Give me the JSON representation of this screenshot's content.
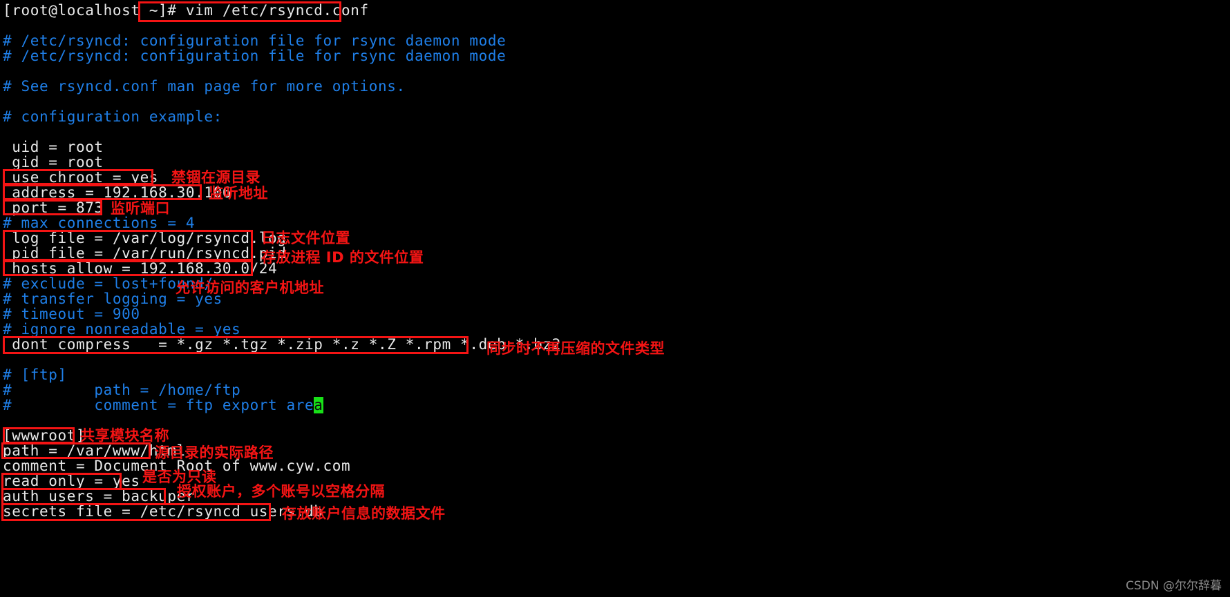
{
  "terminal": {
    "prompt": "[root@localhost ~]#",
    "command": " vim /etc/rsyncd.conf",
    "cursor_char": "a"
  },
  "file": {
    "path": "/etc/rsyncd.conf",
    "lines": [
      {
        "text": "# /etc/rsyncd: configuration file for rsync daemon mode",
        "kind": "comment"
      },
      {
        "text": "# /etc/rsyncd: configuration file for rsync daemon mode",
        "kind": "comment"
      },
      {
        "text": "",
        "kind": "blank"
      },
      {
        "text": "# See rsyncd.conf man page for more options.",
        "kind": "comment"
      },
      {
        "text": "",
        "kind": "blank"
      },
      {
        "text": "# configuration example:",
        "kind": "comment"
      },
      {
        "text": "",
        "kind": "blank"
      },
      {
        "text": " uid = root",
        "kind": "code"
      },
      {
        "text": " gid = root",
        "kind": "code"
      },
      {
        "text": " use chroot = yes",
        "kind": "code"
      },
      {
        "text": " address = 192.168.30.106",
        "kind": "code"
      },
      {
        "text": " port = 873",
        "kind": "code"
      },
      {
        "text": "# max connections = 4",
        "kind": "comment"
      },
      {
        "text": " log file = /var/log/rsyncd.log",
        "kind": "code"
      },
      {
        "text": " pid file = /var/run/rsyncd.pid",
        "kind": "code"
      },
      {
        "text": " hosts allow = 192.168.30.0/24",
        "kind": "code"
      },
      {
        "text": "# exclude = lost+found/",
        "kind": "comment"
      },
      {
        "text": "# transfer logging = yes",
        "kind": "comment"
      },
      {
        "text": "# timeout = 900",
        "kind": "comment"
      },
      {
        "text": "# ignore nonreadable = yes",
        "kind": "comment"
      },
      {
        "text": " dont compress   = *.gz *.tgz *.zip *.z *.Z *.rpm *.deb *.bz2",
        "kind": "code"
      },
      {
        "text": "",
        "kind": "blank"
      },
      {
        "text": "# [ftp]",
        "kind": "comment"
      },
      {
        "text": "#         path = /home/ftp",
        "kind": "comment"
      },
      {
        "text": "#         comment = ftp export area",
        "kind": "comment-cursor"
      },
      {
        "text": "",
        "kind": "blank"
      },
      {
        "text": "[wwwroot]",
        "kind": "code"
      },
      {
        "text": "path = /var/www/html",
        "kind": "code"
      },
      {
        "text": "comment = Document Root of www.cyw.com",
        "kind": "code"
      },
      {
        "text": "read only = yes",
        "kind": "code"
      },
      {
        "text": "auth users = backuper",
        "kind": "code"
      },
      {
        "text": "secrets file = /etc/rsyncd_users.db",
        "kind": "code"
      }
    ]
  },
  "annotations": [
    {
      "id": "use-chroot",
      "label": "禁锢在源目录"
    },
    {
      "id": "address",
      "label": "监听地址"
    },
    {
      "id": "port",
      "label": "监听端口"
    },
    {
      "id": "log-file",
      "label": "日志文件位置"
    },
    {
      "id": "pid-file",
      "label": "存放进程 ID 的文件位置"
    },
    {
      "id": "hosts-allow",
      "label": "允许访问的客户机地址"
    },
    {
      "id": "dont-compress",
      "label": "同步时不再压缩的文件类型"
    },
    {
      "id": "module-name",
      "label": "共享模块名称"
    },
    {
      "id": "path",
      "label": "源目录的实际路径"
    },
    {
      "id": "read-only",
      "label": "是否为只读"
    },
    {
      "id": "auth-users",
      "label": "授权账户，多个账号以空格分隔"
    },
    {
      "id": "secrets-file",
      "label": "存放账户信息的数据文件"
    }
  ],
  "colors": {
    "background": "#000000",
    "comment": "#1f7fe8",
    "code": "#e8e8e8",
    "annotation": "#f41414",
    "cursor": "#18e018",
    "watermark": "#8c8c8c"
  },
  "watermark": {
    "text": "CSDN @尔尔辞暮"
  }
}
